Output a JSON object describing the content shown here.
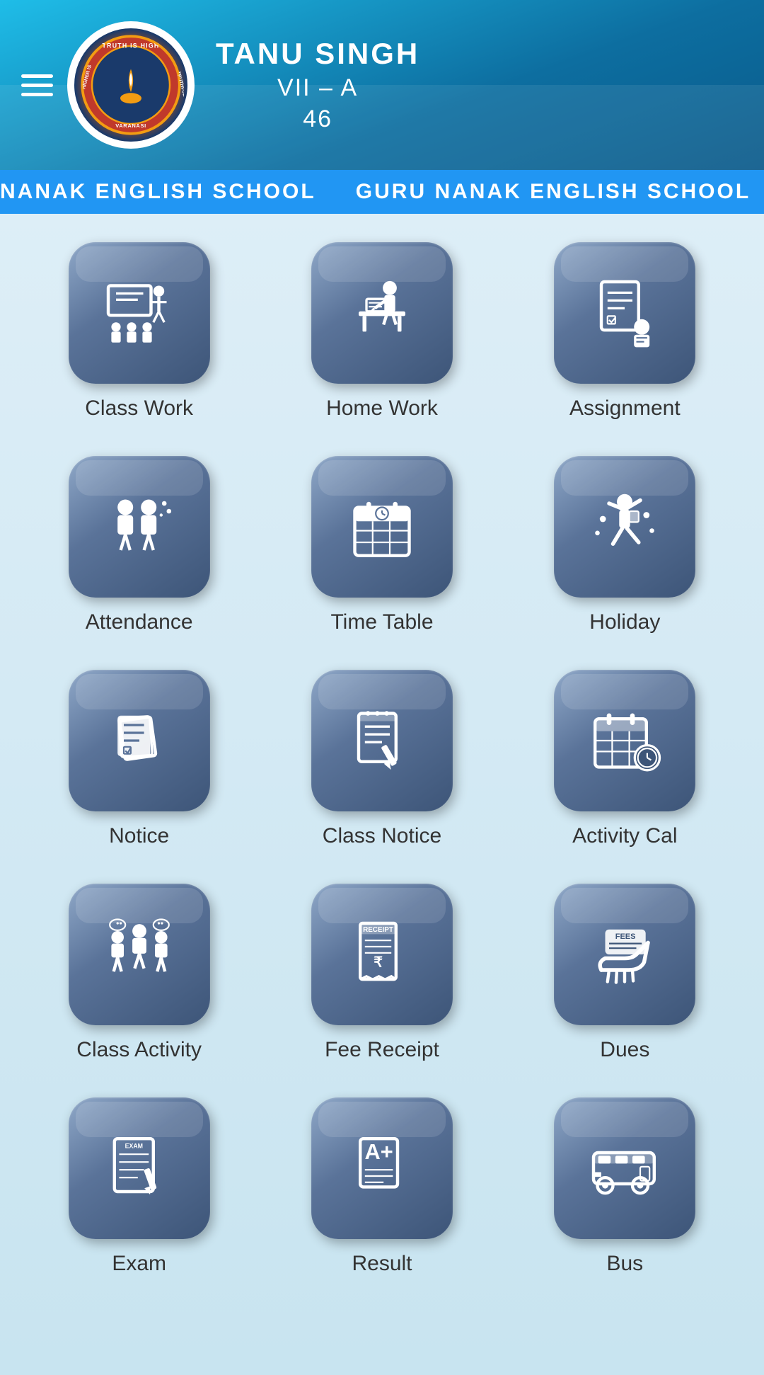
{
  "header": {
    "student_name": "TANU SINGH",
    "class": "VII – A",
    "roll": "46",
    "school_name": "GURU NANAK ENGLISH SCHOOL",
    "school_location": "VARANASI",
    "logo_text": "TRUTH IS HIGH"
  },
  "ticker": {
    "text": "NANAK ENGLISH SCHOOL    GURU NANAK ENGLISH SCHOOL    GURU NANAK ENGLISH SCHOOL    GU"
  },
  "menu": {
    "hamburger_label": "Menu"
  },
  "grid_items": [
    {
      "id": "class-work",
      "label": "Class Work",
      "icon": "classwork"
    },
    {
      "id": "home-work",
      "label": "Home Work",
      "icon": "homework"
    },
    {
      "id": "assignment",
      "label": "Assignment",
      "icon": "assignment"
    },
    {
      "id": "attendance",
      "label": "Attendance",
      "icon": "attendance"
    },
    {
      "id": "time-table",
      "label": "Time Table",
      "icon": "timetable"
    },
    {
      "id": "holiday",
      "label": "Holiday",
      "icon": "holiday"
    },
    {
      "id": "notice",
      "label": "Notice",
      "icon": "notice"
    },
    {
      "id": "class-notice",
      "label": "Class Notice",
      "icon": "classnotice"
    },
    {
      "id": "activity-cal",
      "label": "Activity Cal",
      "icon": "activitycal"
    },
    {
      "id": "class-activity",
      "label": "Class Activity",
      "icon": "classactivity"
    },
    {
      "id": "fee-receipt",
      "label": "Fee Receipt",
      "icon": "feereceipt"
    },
    {
      "id": "dues",
      "label": "Dues",
      "icon": "dues"
    }
  ],
  "partial_items": [
    {
      "id": "exam",
      "label": "Exam",
      "icon": "exam"
    },
    {
      "id": "result",
      "label": "Result",
      "icon": "result"
    },
    {
      "id": "bus",
      "label": "Bus",
      "icon": "bus"
    }
  ]
}
